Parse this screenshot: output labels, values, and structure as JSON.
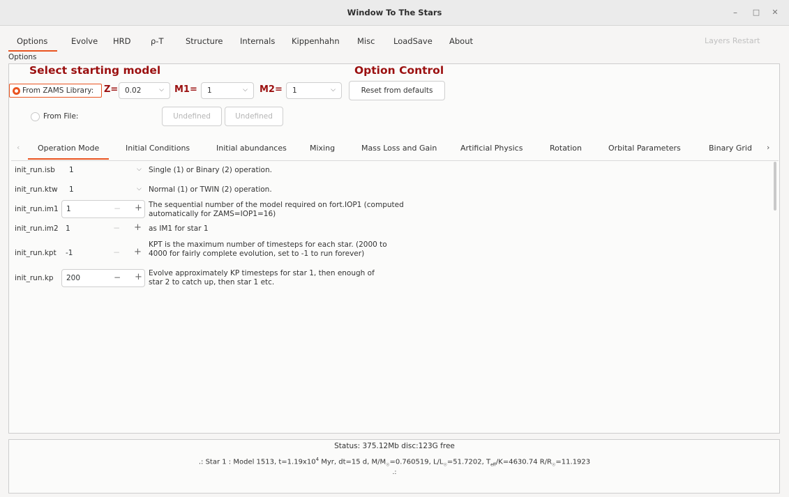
{
  "window": {
    "title": "Window To The Stars",
    "minimize": "–",
    "maximize": "□",
    "close": "✕"
  },
  "main_tabs": [
    "Options",
    "Evolve",
    "HRD",
    "ρ-T",
    "Structure",
    "Internals",
    "Kippenhahn",
    "Misc",
    "LoadSave",
    "About"
  ],
  "layers_restart": "Layers Restart",
  "options_label": "Options",
  "select_model": {
    "heading": "Select starting model",
    "zams_label": "From ZAMS Library:",
    "z_label": "Z=",
    "z_value": "0.02",
    "m1_label": "M1=",
    "m1_value": "1",
    "m2_label": "M2=",
    "m2_value": "1",
    "file_label": "From File:",
    "file_btn1": "Undefined",
    "file_btn2": "Undefined"
  },
  "option_control": {
    "heading": "Option Control",
    "reset_button": "Reset from defaults"
  },
  "inner_tabs": [
    "Operation Mode",
    "Initial Conditions",
    "Initial abundances",
    "Mixing",
    "Mass Loss and Gain",
    "Artificial Physics",
    "Rotation",
    "Orbital Parameters",
    "Binary Grid"
  ],
  "params": [
    {
      "name": "init_run.isb",
      "value": "1",
      "kind": "dropdown",
      "desc": [
        "Single (1) or Binary (2) operation."
      ]
    },
    {
      "name": "init_run.ktw",
      "value": "1",
      "kind": "dropdown",
      "desc": [
        "Normal (1) or TWIN (2) operation."
      ]
    },
    {
      "name": "init_run.im1",
      "value": "1",
      "kind": "spin",
      "desc": [
        "The sequential number of the model required on fort.IOP1 (computed",
        "automatically for ZAMS=IOP1=16)"
      ]
    },
    {
      "name": "init_run.im2",
      "value": "1",
      "kind": "spin",
      "desc": [
        "as IM1 for star 1"
      ]
    },
    {
      "name": "init_run.kpt",
      "value": "-1",
      "kind": "spin",
      "desc": [
        "KPT is the maximum number of timesteps for each star. (2000 to",
        "4000 for fairly complete evolution, set to -1 to run forever)"
      ]
    },
    {
      "name": "init_run.kp",
      "value": "200",
      "kind": "spin",
      "desc": [
        "Evolve approximately KP timesteps for star 1, then enough of",
        "star 2 to catch up, then star 1 etc."
      ]
    }
  ],
  "status": {
    "line1": "Status: 375.12Mb disc:123G free",
    "line2_prefix": ".: Star 1 : Model 1513, ",
    "t_val": "t=1.19x10",
    "t_exp": "4",
    "t_unit": " Myr, dt=15 d, M/M",
    "m_rest": "=0.760519, L/L",
    "l_rest": "=51.7202, T",
    "teff_rest": "/K=4630.74 R/R",
    "r_rest": "=11.1923",
    "line3": ".:"
  }
}
